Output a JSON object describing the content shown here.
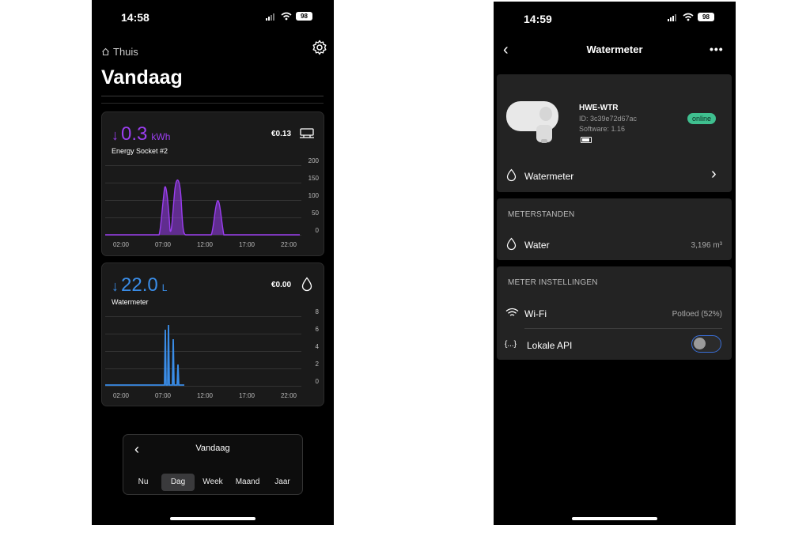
{
  "left": {
    "status": {
      "time": "14:58",
      "battery": "98"
    },
    "breadcrumb": "Thuis",
    "title": "Vandaag",
    "energy": {
      "value": "0.3",
      "unit": "kWh",
      "name": "Energy Socket #2",
      "cost": "€0.13",
      "icon": "power-strip-icon",
      "color": "#9b3ef0",
      "y_ticks": [
        "200",
        "150",
        "100",
        "50",
        "0"
      ],
      "x_ticks": [
        "02:00",
        "07:00",
        "12:00",
        "17:00",
        "22:00"
      ]
    },
    "water": {
      "value": "22.0",
      "unit": "L",
      "name": "Watermeter",
      "cost": "€0.00",
      "icon": "water-drop-icon",
      "color": "#3a8de8",
      "y_ticks": [
        "8",
        "6",
        "4",
        "2",
        "0"
      ],
      "x_ticks": [
        "02:00",
        "07:00",
        "12:00",
        "17:00",
        "22:00"
      ]
    },
    "period_selector": {
      "title": "Vandaag",
      "options": [
        "Nu",
        "Dag",
        "Week",
        "Maand",
        "Jaar"
      ],
      "selected": "Dag"
    }
  },
  "right": {
    "status": {
      "time": "14:59",
      "battery": "98"
    },
    "nav_title": "Watermeter",
    "device": {
      "name": "HWE-WTR",
      "id": "ID: 3c39e72d67ac",
      "software": "Software: 1.16",
      "status": "online"
    },
    "watermeter_row": "Watermeter",
    "readings": {
      "title": "METERSTANDEN",
      "label": "Water",
      "value": "3,196 m³"
    },
    "settings": {
      "title": "METER INSTELLINGEN",
      "wifi_label": "Wi-Fi",
      "wifi_value": "Potloed (52%)",
      "api_icon_text": "{...}",
      "api_label": "Lokale API",
      "api_enabled": false
    }
  }
}
